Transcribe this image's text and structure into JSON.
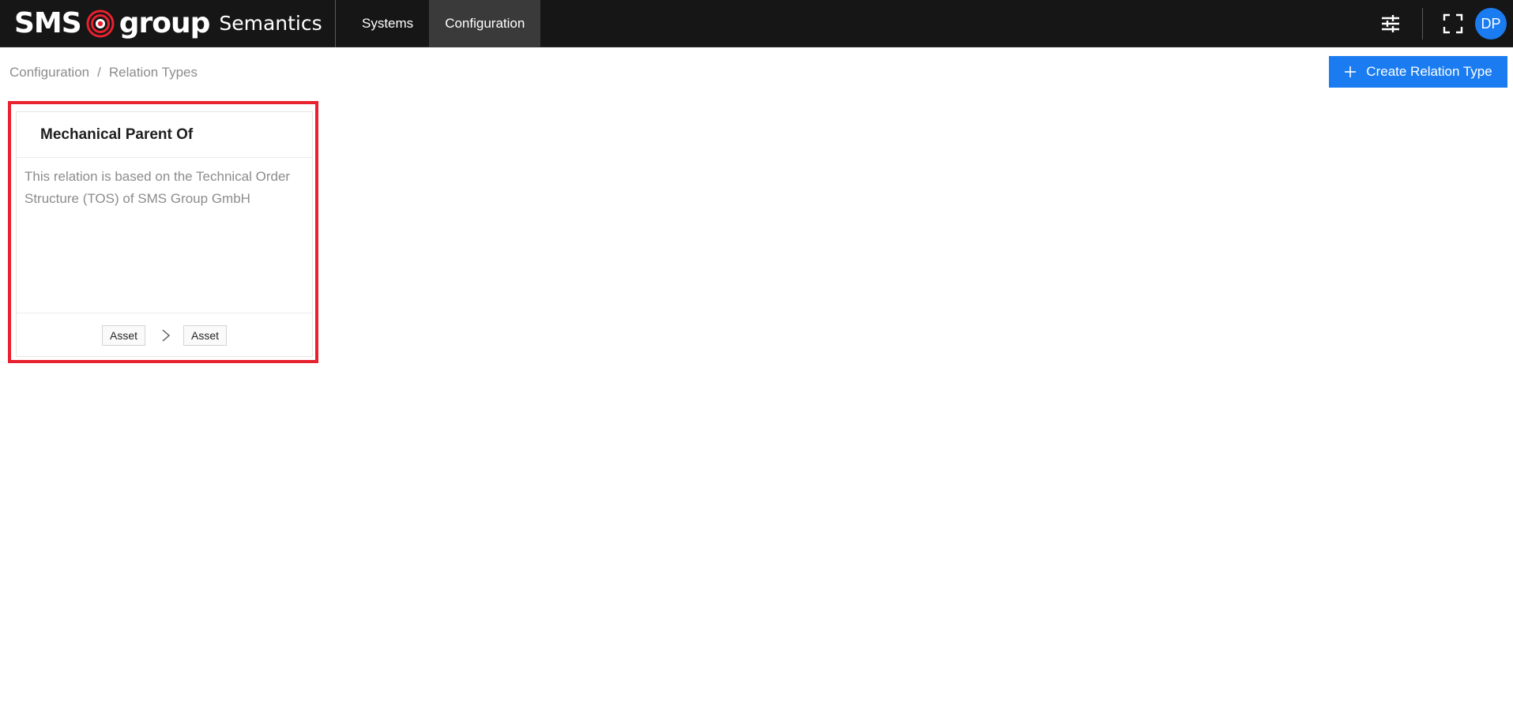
{
  "app": {
    "brand_left": "SMS",
    "brand_right": "group",
    "product": "Semantics"
  },
  "nav": {
    "items": [
      {
        "label": "Systems",
        "active": false
      },
      {
        "label": "Configuration",
        "active": true
      }
    ]
  },
  "header_actions": {
    "settings_icon": "sliders-icon",
    "fullscreen_icon": "fullscreen-icon",
    "avatar_initials": "DP"
  },
  "breadcrumb": {
    "items": [
      "Configuration",
      "Relation Types"
    ],
    "separator": "/"
  },
  "toolbar": {
    "create_label": "Create Relation Type",
    "create_icon": "plus-icon"
  },
  "relation_types": [
    {
      "title": "Mechanical Parent Of",
      "description": "This relation is based on the Technical Order Structure (TOS) of SMS Group GmbH",
      "source": "Asset",
      "target": "Asset"
    }
  ],
  "colors": {
    "topbar_bg": "#161616",
    "accent": "#1a7cf0",
    "highlight": "#e8212e",
    "logo_red": "#e8212e"
  }
}
